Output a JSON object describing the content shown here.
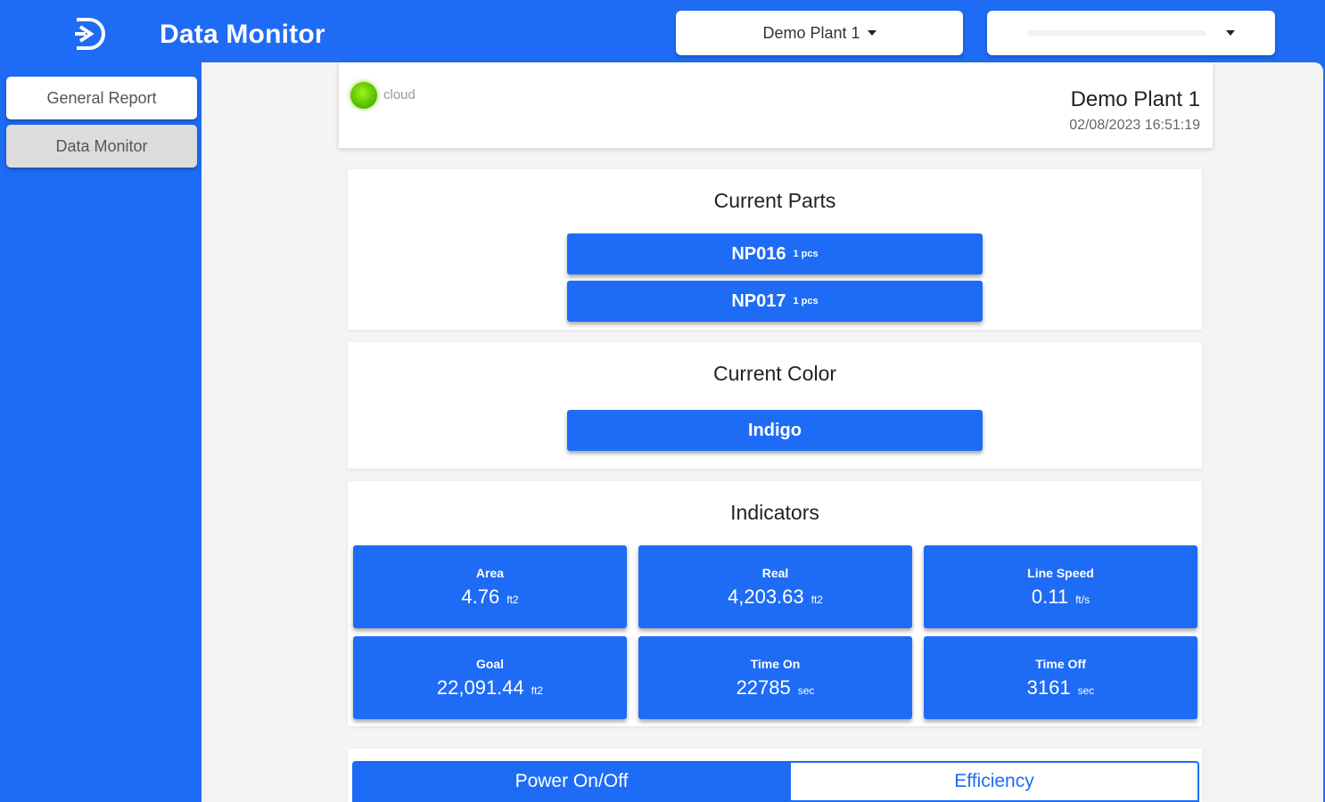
{
  "header": {
    "title": "Data Monitor",
    "plant_select": "Demo Plant 1",
    "secondary_select": ""
  },
  "sidebar": {
    "items": [
      {
        "label": "General Report"
      },
      {
        "label": "Data Monitor"
      }
    ]
  },
  "status": {
    "connection_label": "cloud",
    "plant_name": "Demo Plant 1",
    "timestamp": "02/08/2023 16:51:19"
  },
  "parts": {
    "title": "Current Parts",
    "items": [
      {
        "name": "NP016",
        "qty": "1 pcs"
      },
      {
        "name": "NP017",
        "qty": "1 pcs"
      }
    ]
  },
  "color": {
    "title": "Current Color",
    "value": "Indigo"
  },
  "indicators": {
    "title": "Indicators",
    "tiles": [
      {
        "label": "Area",
        "value": "4.76",
        "unit": "ft2"
      },
      {
        "label": "Real",
        "value": "4,203.63",
        "unit": "ft2"
      },
      {
        "label": "Line Speed",
        "value": "0.11",
        "unit": "ft/s"
      },
      {
        "label": "Goal",
        "value": "22,091.44",
        "unit": "ft2"
      },
      {
        "label": "Time On",
        "value": "22785",
        "unit": "sec"
      },
      {
        "label": "Time Off",
        "value": "3161",
        "unit": "sec"
      }
    ]
  },
  "tabs": [
    {
      "label": "Power On/Off"
    },
    {
      "label": "Efficiency"
    }
  ],
  "colors": {
    "primary": "#1e6cf5",
    "status_online": "#5cc400"
  }
}
